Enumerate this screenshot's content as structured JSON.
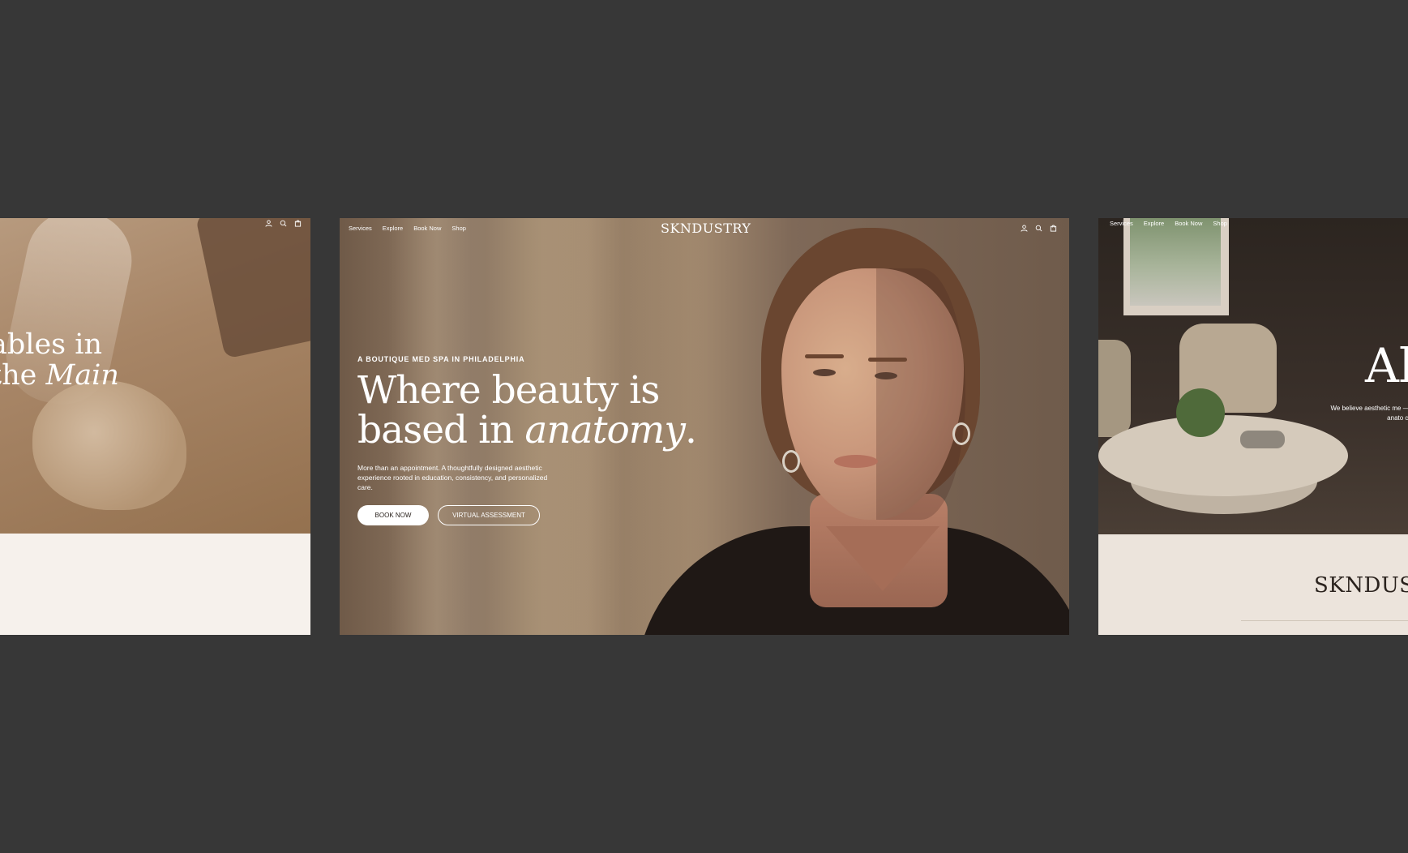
{
  "left_panel": {
    "headline_line1": "ables in",
    "headline_line2_prefix": "the ",
    "headline_line2_italic": "Main"
  },
  "center_panel": {
    "nav": [
      "Services",
      "Explore",
      "Book Now",
      "Shop"
    ],
    "logo": "SKNDUSTRY",
    "eyebrow": "A BOUTIQUE MED SPA IN PHILADELPHIA",
    "title_line1": "Where beauty is",
    "title_line2_prefix": "based in ",
    "title_line2_italic": "anatomy",
    "title_line2_suffix": ".",
    "description": "More than an appointment. A thoughtfully designed aesthetic experience rooted in education, consistency, and personalized care.",
    "primary_cta": "BOOK NOW",
    "secondary_cta": "VIRTUAL ASSESSMENT"
  },
  "right_panel": {
    "nav": [
      "Services",
      "Explore",
      "Book Now",
      "Shop"
    ],
    "headline": "Al",
    "description": "We believe aesthetic me —grounded in anato culture, innov",
    "brand": "SKNDUS"
  },
  "icons": [
    "account-icon",
    "search-icon",
    "cart-icon"
  ],
  "colors": {
    "background": "#373737",
    "cream": "#f6f1ec",
    "dark_text": "#2a221d"
  }
}
